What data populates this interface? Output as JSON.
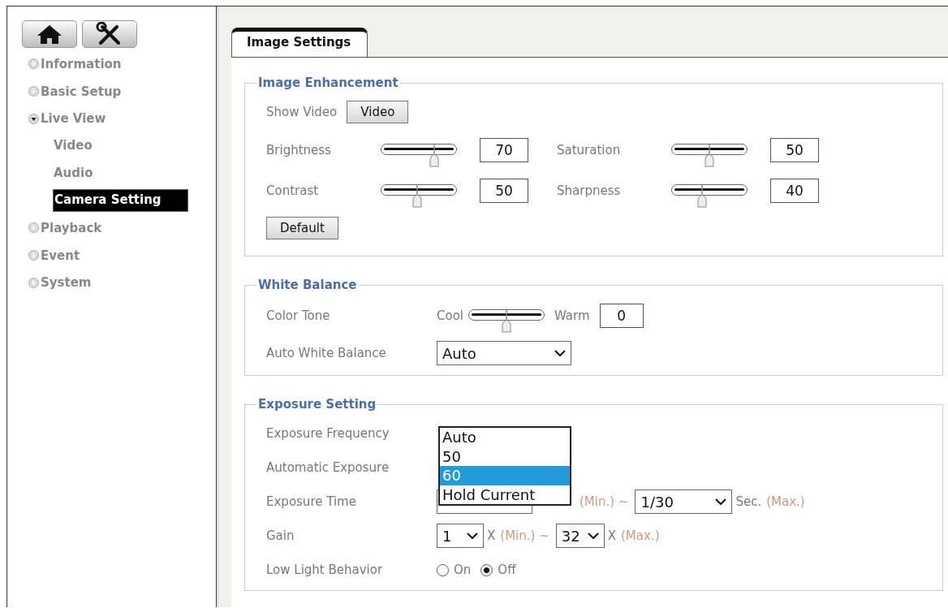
{
  "sidebar": {
    "items": [
      {
        "label": "Information",
        "expanded": false
      },
      {
        "label": "Basic Setup",
        "expanded": false
      },
      {
        "label": "Live View",
        "expanded": true,
        "children": [
          {
            "label": "Video",
            "selected": false
          },
          {
            "label": "Audio",
            "selected": false
          },
          {
            "label": "Camera Setting",
            "selected": true
          }
        ]
      },
      {
        "label": "Playback",
        "expanded": false
      },
      {
        "label": "Event",
        "expanded": false
      },
      {
        "label": "System",
        "expanded": false
      }
    ]
  },
  "tabs": [
    {
      "label": "Image Settings",
      "selected": true
    }
  ],
  "image_enhancement": {
    "title": "Image Enhancement",
    "show_video_label": "Show Video",
    "video_button": "Video",
    "sliders": [
      {
        "label": "Brightness",
        "level": 0.7,
        "value": "70"
      },
      {
        "label": "Saturation",
        "level": 0.5,
        "value": "50"
      },
      {
        "label": "Contrast",
        "level": 0.48,
        "value": "50"
      },
      {
        "label": "Sharpness",
        "level": 0.4,
        "value": "40"
      }
    ],
    "default_button": "Default"
  },
  "white_balance": {
    "title": "White Balance",
    "color_tone": {
      "label": "Color Tone",
      "low": "Cool",
      "high": "Warm",
      "level": 0.5,
      "value": "0"
    },
    "auto_white_balance": {
      "label": "Auto White Balance",
      "value": "Auto"
    }
  },
  "exposure": {
    "title": "Exposure Setting",
    "rows": [
      {
        "kind": "plain",
        "label": "Exposure Frequency"
      },
      {
        "kind": "plain",
        "label": "Automatic Exposure"
      },
      {
        "kind": "time",
        "label": "Exposure Time",
        "min_tail": "(Min.) ~",
        "max": "1/30",
        "max_unit": "Sec.",
        "max_tail": "(Max.)"
      },
      {
        "kind": "gain",
        "label": "Gain",
        "min": "1",
        "min_unit": "X",
        "min_tail": "(Min.) ~",
        "max": "32",
        "max_unit": "X",
        "max_tail": "(Max.)"
      },
      {
        "kind": "radio",
        "label": "Low Light Behavior",
        "options": [
          {
            "label": "On",
            "selected": false
          },
          {
            "label": "Off",
            "selected": true
          }
        ]
      }
    ],
    "dropdown": {
      "options": [
        {
          "label": "Auto",
          "selected": false
        },
        {
          "label": "50",
          "selected": false
        },
        {
          "label": "60",
          "selected": true
        },
        {
          "label": "Hold Current",
          "selected": false
        }
      ]
    }
  }
}
